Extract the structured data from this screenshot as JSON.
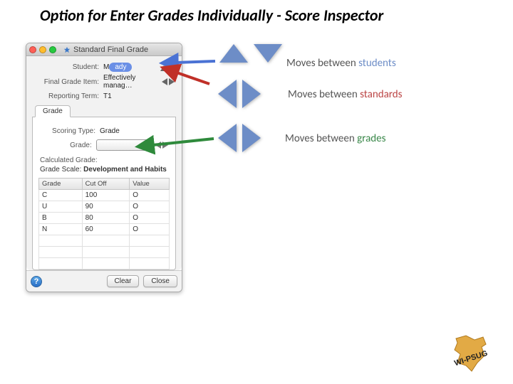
{
  "slide": {
    "title": "Option for Enter Grades Individually - Score Inspector"
  },
  "titlebar": {
    "title": "Standard Final Grade"
  },
  "header": {
    "student_label": "Student:",
    "student_value": "ady",
    "item_label": "Final Grade Item:",
    "item_value": "Effectively manag…",
    "term_label": "Reporting Term:",
    "term_value": "T1"
  },
  "tab": {
    "label": "Grade"
  },
  "grade_section": {
    "scoring_type_label": "Scoring Type:",
    "scoring_type_value": "Grade",
    "grade_label": "Grade:",
    "calc_label": "Calculated Grade:",
    "scale_label": "Grade Scale:",
    "scale_value": "Development and Habits"
  },
  "table": {
    "headers": [
      "Grade",
      "Cut Off",
      "Value"
    ],
    "rows": [
      {
        "grade": "C",
        "cutoff": "100",
        "value": "O"
      },
      {
        "grade": "U",
        "cutoff": "90",
        "value": "O"
      },
      {
        "grade": "B",
        "cutoff": "80",
        "value": "O"
      },
      {
        "grade": "N",
        "cutoff": "60",
        "value": "O"
      }
    ]
  },
  "footer": {
    "help": "?",
    "clear": "Clear",
    "close": "Close"
  },
  "captions": {
    "students_pre": "Moves between ",
    "students_em": "students",
    "standards_pre": "Moves between ",
    "standards_em": "standards",
    "grades_pre": "Moves between ",
    "grades_em": "grades"
  },
  "logo": {
    "text": "WI-PSUG"
  }
}
